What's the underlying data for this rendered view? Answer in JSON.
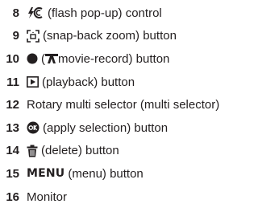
{
  "items": [
    {
      "number": "8",
      "text": "(flash pop-up) control",
      "icon": "flash-pop-up-icon"
    },
    {
      "number": "9",
      "text": "(snap-back zoom) button",
      "icon": "snap-back-zoom-icon"
    },
    {
      "number": "10",
      "text_open": "(",
      "text_close": " movie-record) button",
      "icon": "record-dot-icon",
      "icon2": "movie-camera-icon"
    },
    {
      "number": "11",
      "text": "(playback) button",
      "icon": "playback-icon"
    },
    {
      "number": "12",
      "text": "Rotary multi selector (multi selector)"
    },
    {
      "number": "13",
      "text": "(apply selection) button",
      "icon": "ok-icon"
    },
    {
      "number": "14",
      "text": "(delete) button",
      "icon": "delete-icon"
    },
    {
      "number": "15",
      "label": "MENU",
      "text": "(menu) button"
    },
    {
      "number": "16",
      "text": "Monitor"
    }
  ],
  "colors": {
    "number": "#231f20",
    "text": "#231f20"
  }
}
